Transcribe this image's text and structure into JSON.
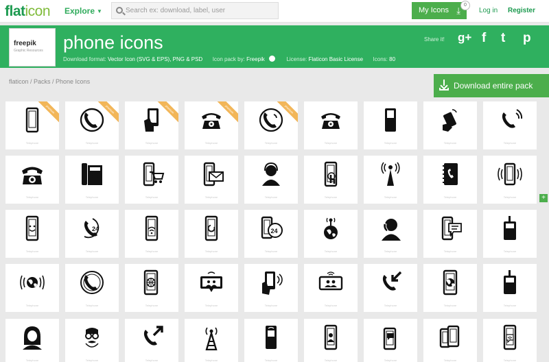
{
  "nav": {
    "logo_a": "flat",
    "logo_b": "icon",
    "explore": "Explore",
    "search_placeholder": "Search ex: download, label, user",
    "my_icons": "My Icons",
    "my_icons_count": "0",
    "login": "Log in",
    "register": "Register"
  },
  "banner": {
    "brand": "freepik",
    "brand_sub": "Graphic Resources",
    "title": "phone icons",
    "format_label": "Download format:",
    "format_value": "Vector Icon (SVG & EPS), PNG & PSD",
    "pack_label": "Icon pack by:",
    "pack_value": "Freepik",
    "license_label": "License:",
    "license_value": "Flaticon Basic License",
    "icons_label": "Icons:",
    "icons_value": "80",
    "share": "Share it!",
    "social": [
      "g+",
      "f",
      "t",
      "p"
    ]
  },
  "breadcrumb": "flaticon / Packs / Phone Icons",
  "download_label": "Download entire pack",
  "side_button": "+",
  "accent_color": "#2fb05f",
  "grid_label": "Telephone",
  "ribbon_text": "premium",
  "icons": [
    [
      {
        "icon": "smartphone-icon",
        "ribbon": true
      },
      {
        "icon": "phone-handset-circle-icon",
        "ribbon": true
      },
      {
        "icon": "hand-holding-phone-icon",
        "ribbon": true
      },
      {
        "icon": "old-telephone-icon",
        "ribbon": true
      },
      {
        "icon": "phone-call-circle-icon",
        "ribbon": true
      },
      {
        "icon": "rotary-telephone-icon",
        "ribbon": false
      },
      {
        "icon": "mobile-phone-keypad-icon",
        "ribbon": false
      },
      {
        "icon": "hand-phone-signal-icon",
        "ribbon": false
      },
      {
        "icon": "handset-ringing-icon",
        "ribbon": false
      }
    ],
    [
      {
        "icon": "rotary-dial-phone-icon",
        "ribbon": false
      },
      {
        "icon": "office-phone-icon",
        "ribbon": false
      },
      {
        "icon": "mobile-shopping-cart-icon",
        "ribbon": false
      },
      {
        "icon": "mobile-mail-icon",
        "ribbon": false
      },
      {
        "icon": "operator-headset-icon",
        "ribbon": false
      },
      {
        "icon": "touch-screen-icon",
        "ribbon": false
      },
      {
        "icon": "antenna-tower-icon",
        "ribbon": false
      },
      {
        "icon": "phone-book-icon",
        "ribbon": false
      },
      {
        "icon": "vibrating-phone-icon",
        "ribbon": false
      }
    ],
    [
      {
        "icon": "smiley-phone-icon",
        "ribbon": false
      },
      {
        "icon": "support-24-icon",
        "ribbon": false
      },
      {
        "icon": "phone-wifi-icon",
        "ribbon": false
      },
      {
        "icon": "phone-loading-icon",
        "ribbon": false
      },
      {
        "icon": "mobile-24-icon",
        "ribbon": false
      },
      {
        "icon": "globe-antenna-icon",
        "ribbon": false
      },
      {
        "icon": "person-on-phone-icon",
        "ribbon": false
      },
      {
        "icon": "mobile-chat-icon",
        "ribbon": false
      },
      {
        "icon": "walkie-talkie-icon",
        "ribbon": false
      }
    ],
    [
      {
        "icon": "globe-waves-icon",
        "ribbon": false
      },
      {
        "icon": "phone-circle-waves-icon",
        "ribbon": false
      },
      {
        "icon": "phone-globe-icon",
        "ribbon": false
      },
      {
        "icon": "video-call-icon",
        "ribbon": false
      },
      {
        "icon": "hand-phone-waves-icon",
        "ribbon": false
      },
      {
        "icon": "phone-contacts-icon",
        "ribbon": false
      },
      {
        "icon": "incoming-call-icon",
        "ribbon": false
      },
      {
        "icon": "phone-world-icon",
        "ribbon": false
      },
      {
        "icon": "cordless-phone-icon",
        "ribbon": false
      }
    ],
    [
      {
        "icon": "call-center-woman-icon",
        "ribbon": false
      },
      {
        "icon": "nerd-face-icon",
        "ribbon": false
      },
      {
        "icon": "outgoing-call-icon",
        "ribbon": false
      },
      {
        "icon": "radio-tower-icon",
        "ribbon": false
      },
      {
        "icon": "mobile-signal-icon",
        "ribbon": false
      },
      {
        "icon": "mobile-contact-icon",
        "ribbon": false
      },
      {
        "icon": "mobile-speech-icon",
        "ribbon": false
      },
      {
        "icon": "two-phones-icon",
        "ribbon": false
      },
      {
        "icon": "phone-wifi-speech-icon",
        "ribbon": false
      }
    ]
  ]
}
